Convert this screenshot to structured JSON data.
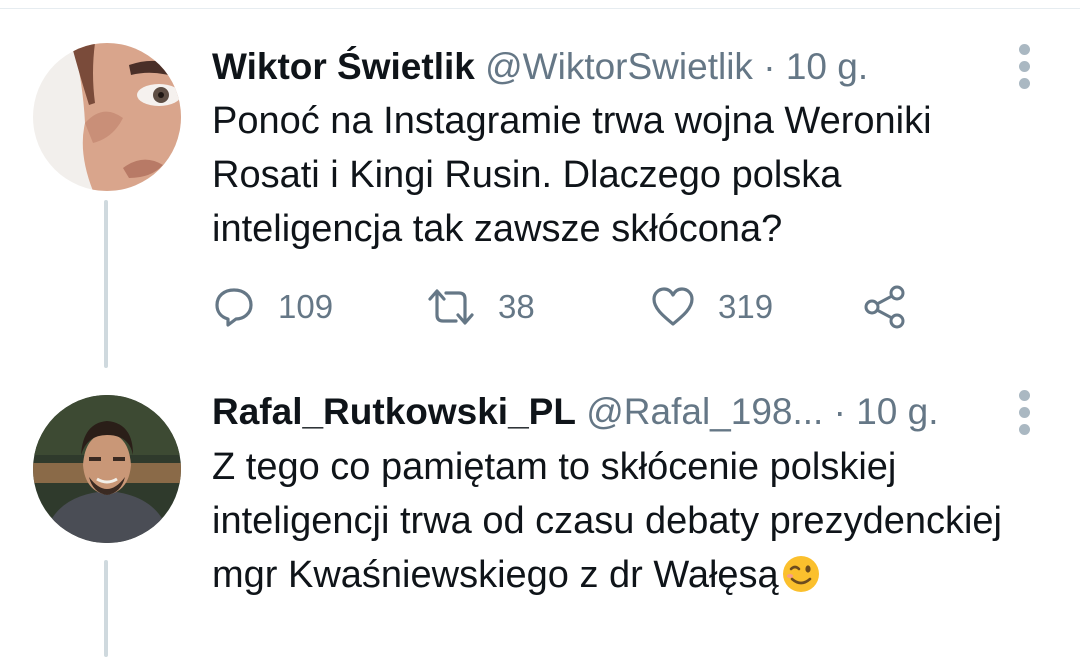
{
  "tweets": [
    {
      "name": "Wiktor Świetlik",
      "handle": "@WiktorSwietlik",
      "separator": "·",
      "time": "10 g.",
      "text": "Ponoć na Instagramie trwa wojna Weroniki Rosati i Kingi Rusin. Dlaczego polska inteligencja tak zawsze skłócona?",
      "reply_count": "109",
      "retweet_count": "38",
      "like_count": "319"
    },
    {
      "name": "Rafal_Rutkowski_PL",
      "handle": "@Rafal_198...",
      "separator": "·",
      "time": "10 g.",
      "text": "Z tego co pamiętam to skłócenie polskiej inteligencji trwa od czasu debaty prezydenckiej mgr Kwaśniewskiego z dr Wałęsą",
      "emoji": "winking-face"
    }
  ],
  "colors": {
    "primary_text": "#0f1419",
    "secondary_text": "#657786",
    "thread_line": "#cfd9de",
    "icon": "#657786"
  }
}
